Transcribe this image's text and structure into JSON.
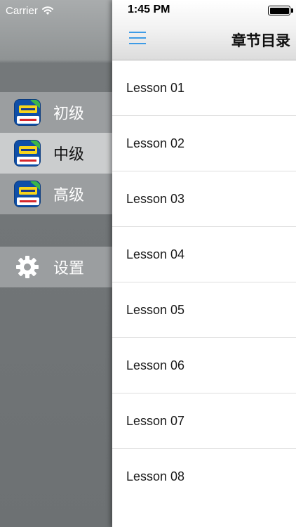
{
  "status_bar": {
    "carrier": "Carrier",
    "time": "1:45 PM",
    "battery_level": 1.0
  },
  "drawer": {
    "levels": [
      {
        "label": "初级",
        "icon": "app-logo-icon",
        "selected": false
      },
      {
        "label": "中级",
        "icon": "app-logo-icon",
        "selected": true
      },
      {
        "label": "高级",
        "icon": "app-logo-icon",
        "selected": false
      }
    ],
    "settings": {
      "label": "设置",
      "icon": "gear-icon"
    }
  },
  "nav": {
    "title": "章节目录",
    "menu_icon": "hamburger-icon",
    "accent_color": "#3d9be6"
  },
  "lessons": [
    "Lesson 01",
    "Lesson 02",
    "Lesson 03",
    "Lesson 04",
    "Lesson 05",
    "Lesson 06",
    "Lesson 07",
    "Lesson 08"
  ]
}
